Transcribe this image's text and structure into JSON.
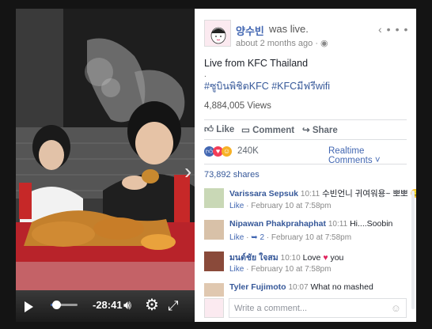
{
  "video": {
    "elapsed_fraction": 0.2,
    "time_remaining": "-28:41",
    "controls": {
      "play": "play-icon",
      "volume": "speaker-icon",
      "settings": "gear-icon",
      "fullscreen": "fullscreen-icon"
    },
    "accent": "#4267b2"
  },
  "post": {
    "author": "양수빈",
    "action": "was live.",
    "time": "about 2 months ago",
    "privacy_icon": "globe-icon",
    "title": "Live from KFC Thailand",
    "dot": ".",
    "hashtags": "#ซูบินพิชิตKFC #KFCมีฟรีwifi",
    "views": "4,884,005 Views",
    "actions": {
      "like": "Like",
      "comment": "Comment",
      "share": "Share"
    },
    "reaction_count": "240K",
    "realtime": "Realtime Comments",
    "shares": "73,892 shares"
  },
  "comments": [
    {
      "name": "Varissara Sepsuk",
      "time": "10:11",
      "text": "수빈언니 귀여워용~ 뽀뽀",
      "reply": "",
      "date": "February 10 at 7:58pm"
    },
    {
      "name": "Nipawan Phakprahaphat",
      "time": "10:11",
      "text": "Hi....Soobin",
      "reply": "2",
      "date": "February 10 at 7:58pm"
    },
    {
      "name": "มนต์ชัย ใจสม",
      "time": "10:10",
      "text": "Love",
      "text2": "you",
      "reply": "",
      "date": "February 10 at 7:58pm"
    },
    {
      "name": "Tyler Fujimoto",
      "time": "10:07",
      "text": "What no mashed",
      "reply": "",
      "date": ""
    }
  ],
  "compose": {
    "placeholder": "Write a comment..."
  },
  "like_label": "Like",
  "dot_sep": "·"
}
